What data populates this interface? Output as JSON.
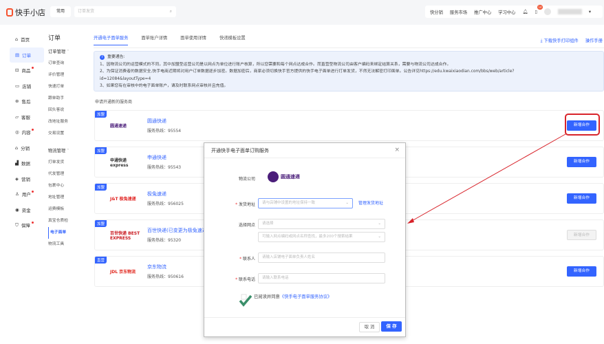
{
  "header": {
    "app_name": "快手小店",
    "common_label": "常用",
    "search_placeholder": "订单发货",
    "nav": [
      "快分销",
      "服务市场",
      "推广中心",
      "学习中心"
    ],
    "notification_count": "14"
  },
  "sidebar": {
    "primary": [
      {
        "label": "首页",
        "icon": "home-icon"
      },
      {
        "label": "订单",
        "icon": "order-icon",
        "active": true
      },
      {
        "label": "商品",
        "icon": "goods-icon",
        "dot": true
      },
      {
        "label": "店铺",
        "icon": "store-icon"
      },
      {
        "label": "售后",
        "icon": "aftersale-icon"
      },
      {
        "label": "客服",
        "icon": "chat-icon"
      },
      {
        "label": "内容",
        "icon": "content-icon",
        "dot": true
      },
      {
        "label": "分销",
        "icon": "distribution-icon"
      },
      {
        "label": "数据",
        "icon": "chart-icon"
      },
      {
        "label": "营销",
        "icon": "marketing-icon"
      },
      {
        "label": "用户",
        "icon": "user-icon",
        "dot": true
      },
      {
        "label": "资金",
        "icon": "funds-icon"
      },
      {
        "label": "保障",
        "icon": "shield-icon",
        "dot": true
      }
    ],
    "section_title": "订单",
    "secondary": [
      "订单管理",
      "订单查询",
      "评价管理",
      "快速打单",
      "跟单助手",
      "回头客说",
      "改地址服务",
      "交易设置",
      "物流管理",
      "打单发货",
      "代发管理",
      "包裹中心",
      "地址管理",
      "运费模板",
      "真宝仓质检",
      "电子面单",
      "物流工具"
    ]
  },
  "main": {
    "tabs": [
      "开通电子面单服务",
      "面单账户详情",
      "面单使用详情",
      "快递模板设置"
    ],
    "download_link": "下载快手打印组件",
    "manual_link": "操作手册",
    "notice": {
      "title": "重要通告:",
      "lines": [
        "1、因物流公司的运营模式的不同，其中加盟型运营公司是以网点为单位进行账户核算，所以您需要和每个网点达成合作。而直营型物流公司由客户编码来绑定结算关系，需要与物流公司达成合作。",
        "2、为保证消费者的数据安全,快手电商近期将对用户订单数据逐步加密。数据加密后，商家必须切换快手官方提供的快手电子面单进行打单发货，不然无法解密打印面单。公告详见https://edu.kwaixiaodian.com/bbs/web/article?",
        "id=12084&layoutType=4",
        "3、如果您有在审核中的电子面单账户，请及时联系网点审核并且充值。"
      ]
    },
    "section_label": "申请开通新的服务商",
    "providers": [
      {
        "tag": "加盟",
        "logo": "圆通速递",
        "name": "圆通快递",
        "hotline": "服务热线：95554",
        "button": "新增合作",
        "disabled": false
      },
      {
        "tag": "加盟",
        "logo": "申通快递 express",
        "name": "申通快递",
        "hotline": "服务热线：95543",
        "button": "新增合作",
        "disabled": false
      },
      {
        "tag": "加盟",
        "logo": "J&T 极兔速递",
        "name": "极兔速递",
        "hotline": "服务热线：956025",
        "button": "新增合作",
        "disabled": false
      },
      {
        "tag": "加盟",
        "logo": "百世快递 BEST EXPRESS",
        "name": "百世快递(已变更为极兔速递)",
        "hotline": "服务热线：95320",
        "button": "新增合作",
        "disabled": true
      },
      {
        "tag": "直营",
        "logo": "JDL 京东物流",
        "name": "京东物流",
        "hotline": "服务热线：950616",
        "button": "新增合作",
        "disabled": false
      }
    ]
  },
  "modal": {
    "title": "开通快手电子面单订购服务",
    "company_label": "物流公司",
    "company_name": "圆通速递",
    "address_label": "发货地址",
    "address_placeholder": "请与店铺中设置的地址保持一致",
    "manage_address": "管理发货地址",
    "outlet_label": "选择网点",
    "outlet_placeholder": "请选择",
    "outlet_search_placeholder": "可输入网点编码或网点名称查找，最多200个搜索结果",
    "contact_label": "联系人",
    "contact_placeholder": "请输入店铺电子面单负责人姓名",
    "phone_label": "联系电话",
    "phone_placeholder": "请输入联系电话",
    "agree_text": "已阅读并同意",
    "agreement_link": "《快手电子面单服务协议》",
    "cancel": "取 消",
    "save": "保 存"
  },
  "colors": {
    "accent": "#3364ff",
    "annotation": "#d8232a",
    "check": "#3a8f6a"
  }
}
